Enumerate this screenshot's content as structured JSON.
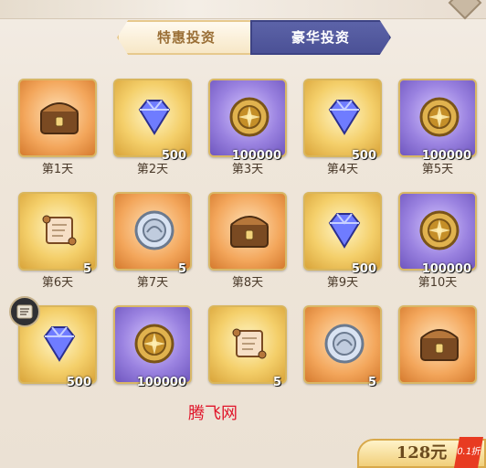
{
  "tabs": {
    "left_label": "特惠投资",
    "right_label": "豪华投资"
  },
  "items": [
    {
      "day": "第1天",
      "type": "chest",
      "qty": ""
    },
    {
      "day": "第2天",
      "type": "diamond",
      "qty": "500"
    },
    {
      "day": "第3天",
      "type": "coin",
      "qty": "100000"
    },
    {
      "day": "第4天",
      "type": "diamond",
      "qty": "500"
    },
    {
      "day": "第5天",
      "type": "coin",
      "qty": "100000"
    },
    {
      "day": "第6天",
      "type": "scroll",
      "qty": "5"
    },
    {
      "day": "第7天",
      "type": "silver",
      "qty": "5"
    },
    {
      "day": "第8天",
      "type": "chest",
      "qty": ""
    },
    {
      "day": "第9天",
      "type": "diamond",
      "qty": "500"
    },
    {
      "day": "第10天",
      "type": "coin",
      "qty": "100000"
    },
    {
      "day": "",
      "type": "diamond",
      "qty": "500"
    },
    {
      "day": "",
      "type": "coin",
      "qty": "100000"
    },
    {
      "day": "",
      "type": "scroll",
      "qty": "5"
    },
    {
      "day": "",
      "type": "silver",
      "qty": "5"
    },
    {
      "day": "",
      "type": "chest",
      "qty": ""
    }
  ],
  "watermark": "腾飞网",
  "price": "128元",
  "discount": "0.1折",
  "icons": {
    "quest": "quest-icon",
    "chest": "chest-icon",
    "diamond": "diamond-icon",
    "coin": "coin-icon",
    "scroll": "scroll-icon",
    "silver": "silver-coin-icon"
  }
}
